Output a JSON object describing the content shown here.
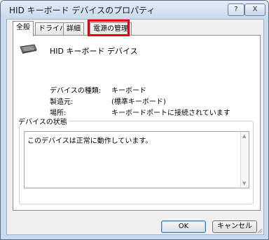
{
  "window": {
    "title": "HID キーボード デバイスのプロパティ",
    "help_label": "?",
    "close_label": "X"
  },
  "tabs": [
    {
      "label": "全般",
      "active": true
    },
    {
      "label": "ドライバ",
      "active": false
    },
    {
      "label": "詳細",
      "active": false
    },
    {
      "label": "電源の管理",
      "active": false,
      "highlighted": true
    }
  ],
  "device": {
    "name": "HID キーボード デバイス",
    "icon": "keyboard-icon",
    "properties": [
      {
        "label": "デバイスの種類:",
        "value": "キーボード"
      },
      {
        "label": "製造元:",
        "value": "(標準キーボード)"
      },
      {
        "label": "場所:",
        "value": "キーボードポートに接続されています"
      }
    ]
  },
  "status": {
    "group_label": "デバイスの状態",
    "text": "このデバイスは正常に動作しています。"
  },
  "buttons": {
    "ok": "OK",
    "cancel": "キャンセル"
  },
  "colors": {
    "highlight": "#e60012",
    "title_bar": "#c9daee"
  }
}
